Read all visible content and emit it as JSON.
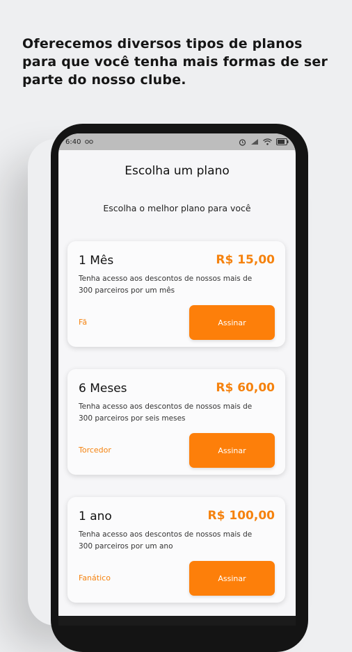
{
  "headline": "Oferecemos diversos tipos de planos para que você tenha mais formas de ser parte do nosso clube.",
  "status_bar": {
    "time": "6:40"
  },
  "app": {
    "title": "Escolha um plano",
    "subtitle": "Escolha o melhor plano para você"
  },
  "plans": [
    {
      "name": "1 Mês",
      "price": "R$ 15,00",
      "description": "Tenha acesso aos descontos de nossos mais de 300 parceiros  por um mês",
      "tier": "Fã",
      "button": "Assinar"
    },
    {
      "name": "6 Meses",
      "price": "R$ 60,00",
      "description": "Tenha acesso aos descontos de nossos mais de 300 parceiros  por seis meses",
      "tier": "Torcedor",
      "button": "Assinar"
    },
    {
      "name": "1 ano",
      "price": "R$ 100,00",
      "description": "Tenha acesso aos descontos de nossos mais de 300 parceiros  por um ano",
      "tier": "Fanático",
      "button": "Assinar"
    }
  ],
  "colors": {
    "accent": "#fd7f0a",
    "price": "#f5820e",
    "background": "#eeeff1"
  }
}
